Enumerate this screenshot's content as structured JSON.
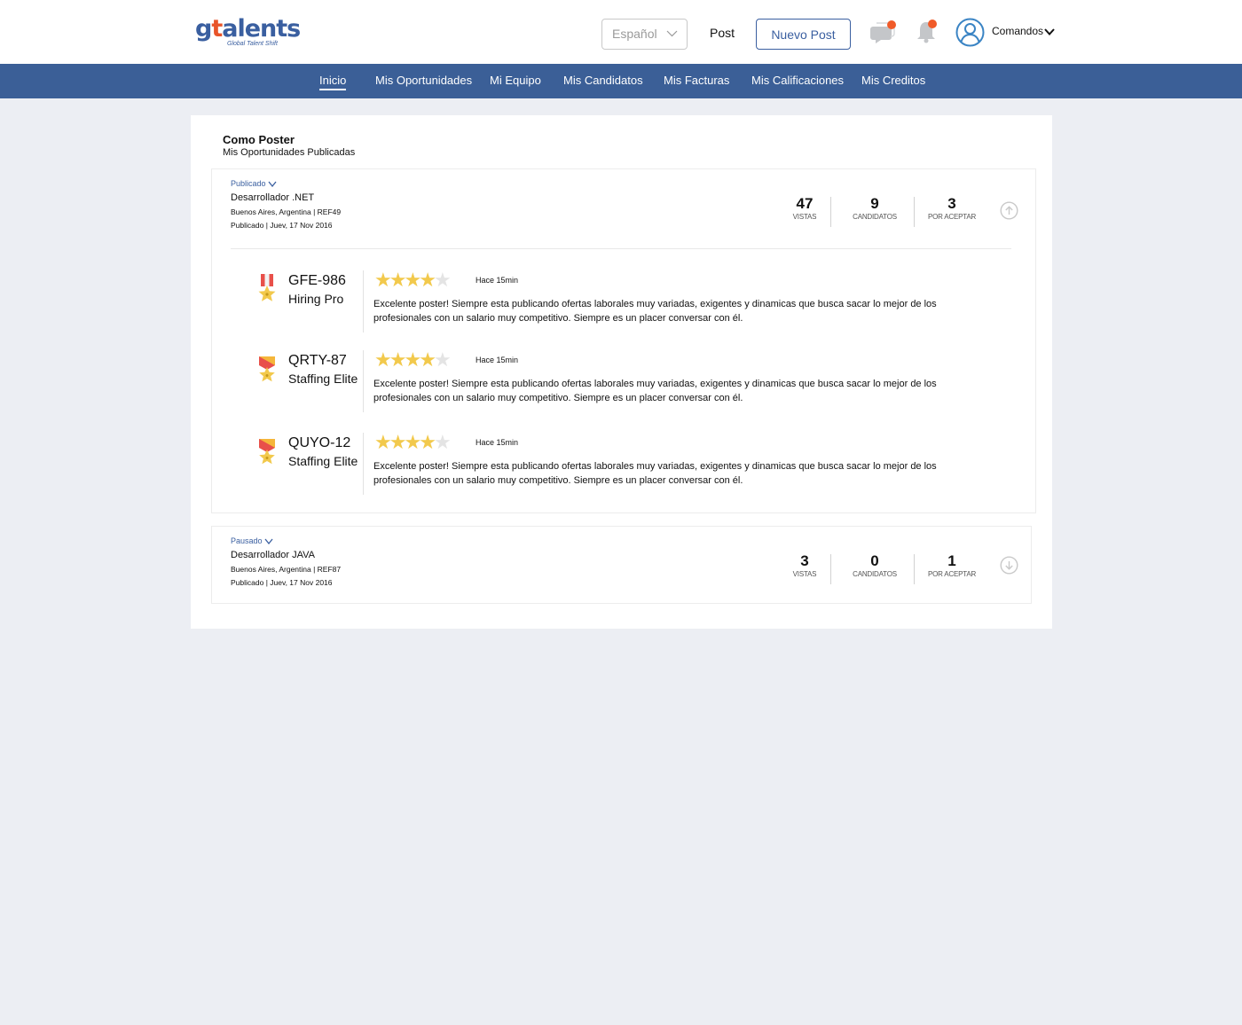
{
  "header": {
    "logo_text_g": "g",
    "logo_text_t": "t",
    "logo_text_rest": "alents",
    "logo_tagline": "Global Talent Shift",
    "language": "Español",
    "post_label": "Post",
    "new_post_label": "Nuevo Post",
    "user_menu_label": "Comandos",
    "colors": {
      "brand": "#3a5fa0",
      "notify": "#f05a28"
    }
  },
  "nav": {
    "items": [
      {
        "label": "Inicio",
        "active": true
      },
      {
        "label": "Mis Oportunidades"
      },
      {
        "label": "Mi Equipo"
      },
      {
        "label": "Mis Candidatos"
      },
      {
        "label": "Mis Facturas"
      },
      {
        "label": "Mis Calificaciones"
      },
      {
        "label": "Mis Creditos"
      }
    ]
  },
  "section": {
    "title": "Como Poster",
    "subtitle": "Mis Oportunidades Publicadas"
  },
  "jobs": [
    {
      "status": "Publicado",
      "title": "Desarrollador .NET",
      "location": "Buenos Aires, Argentina | REF49",
      "date": "Publicado | Juev, 17 Nov 2016",
      "stats": [
        {
          "value": "47",
          "label": "VISTAS"
        },
        {
          "value": "9",
          "label": "CANDIDATOS"
        },
        {
          "value": "3",
          "label": "POR ACEPTAR"
        }
      ],
      "expanded": true,
      "reviews": [
        {
          "code": "GFE-986",
          "level": "Hiring Pro",
          "rating": 4,
          "time": "Hace 15min",
          "text": "Excelente poster! Siempre esta publicando ofertas laborales muy variadas, exigentes y dinamicas que busca sacar lo mejor de los profesionales con un salario muy competitivo. Siempre es un placer conversar con él."
        },
        {
          "code": "QRTY-87",
          "level": "Staffing Elite",
          "rating": 4,
          "time": "Hace 15min",
          "text": "Excelente poster! Siempre esta publicando ofertas laborales muy variadas, exigentes y dinamicas que busca sacar lo mejor de los profesionales con un salario muy competitivo. Siempre es un placer conversar con él."
        },
        {
          "code": "QUYO-12",
          "level": "Staffing Elite",
          "rating": 4,
          "time": "Hace 15min",
          "text": "Excelente poster! Siempre esta publicando ofertas laborales muy variadas, exigentes y dinamicas que busca sacar lo mejor de los profesionales con un salario muy competitivo. Siempre es un placer conversar con él."
        }
      ]
    },
    {
      "status": "Pausado",
      "title": "Desarrollador JAVA",
      "location": "Buenos Aires, Argentina | REF87",
      "date": "Publicado | Juev, 17 Nov 2016",
      "stats": [
        {
          "value": "3",
          "label": "VISTAS"
        },
        {
          "value": "0",
          "label": "CANDIDATOS"
        },
        {
          "value": "1",
          "label": "POR ACEPTAR"
        }
      ],
      "expanded": false
    }
  ]
}
